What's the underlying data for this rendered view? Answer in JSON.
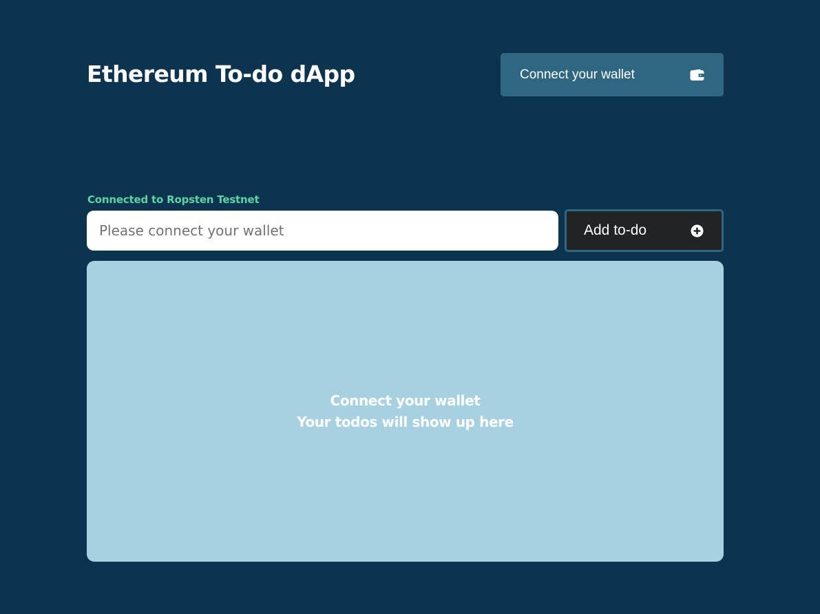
{
  "header": {
    "title": "Ethereum To-do dApp",
    "connect_button": {
      "label": "Connect your wallet",
      "icon": "wallet-icon"
    }
  },
  "status": {
    "network_text": "Connected to Ropsten Testnet",
    "color": "#5ed3a6"
  },
  "todo_form": {
    "input_value": "",
    "input_placeholder": "Please connect your wallet",
    "add_button": {
      "label": "Add to-do",
      "icon": "plus-circle-icon"
    }
  },
  "todo_list": {
    "empty_title": "Connect your wallet",
    "empty_subtitle": "Your todos will show up here"
  },
  "colors": {
    "background": "#0d344e",
    "connect_button": "#2f6782",
    "add_button": "#222325",
    "panel": "#a7d0e0",
    "status_text": "#5ed3a6"
  }
}
